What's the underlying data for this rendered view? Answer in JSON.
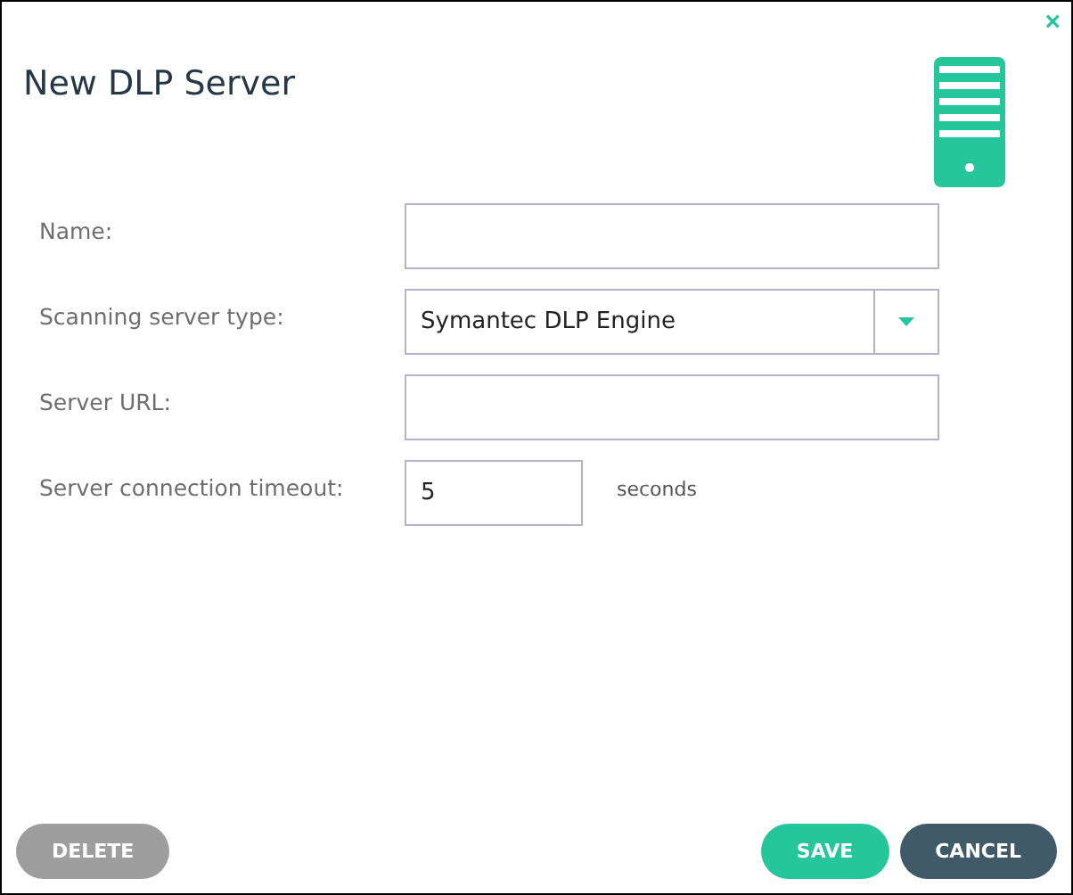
{
  "dialog": {
    "title": "New DLP Server",
    "close": "×"
  },
  "fields": [
    {
      "kind": "text",
      "label": "Name:"
    },
    {
      "kind": "select",
      "label": "Scanning server type:",
      "value": "Symantec DLP Engine"
    },
    {
      "kind": "text",
      "label": "Server URL:"
    },
    {
      "kind": "number",
      "label": "Server connection timeout:",
      "value": "5",
      "suffix": "seconds"
    }
  ],
  "buttons": [
    {
      "label": "DELETE",
      "kind": "neutral"
    },
    {
      "label": "SAVE",
      "kind": "primary"
    },
    {
      "label": "CANCEL",
      "kind": "secondary"
    }
  ]
}
